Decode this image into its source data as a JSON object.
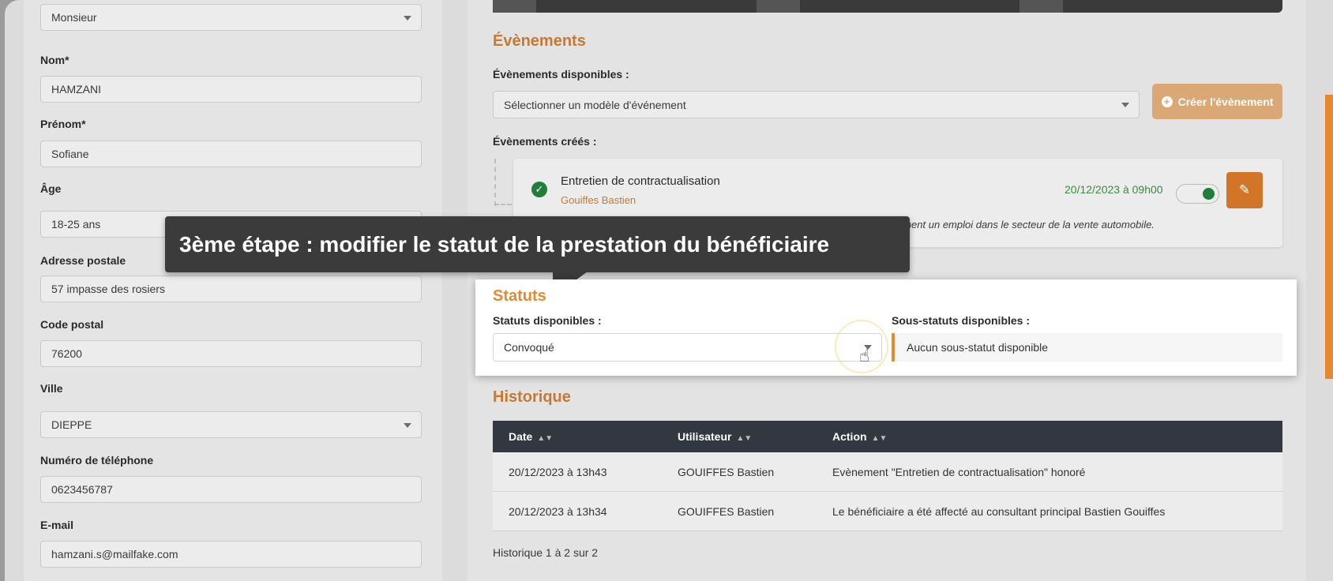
{
  "beneficiary_form": {
    "civility": "Monsieur",
    "fields": [
      {
        "label": "Nom*",
        "value": "HAMZANI"
      },
      {
        "label": "Prénom*",
        "value": "Sofiane"
      },
      {
        "label": "Âge",
        "value": "18-25 ans"
      },
      {
        "label": "Adresse postale",
        "value": "57 impasse des rosiers"
      },
      {
        "label": "Code postal",
        "value": "76200"
      },
      {
        "label": "Ville",
        "value": "DIEPPE"
      },
      {
        "label": "Numéro de téléphone",
        "value": "0623456787"
      },
      {
        "label": "E-mail",
        "value": "hamzani.s@mailfake.com"
      }
    ]
  },
  "events": {
    "title": "Évènements",
    "available_label": "Évènements disponibles :",
    "select_placeholder": "Sélectionner un modèle d'événement",
    "create_button": "Créer l'évènement",
    "created_label": "Évènements créés :",
    "item": {
      "title": "Entretien de contractualisation",
      "author": "Gouiffes Bastien",
      "datetime": "20/12/2023 à 09h00",
      "description_visible": "ement un emploi dans le secteur de la vente automobile."
    }
  },
  "tooltip": "3ème étape : modifier le statut de la prestation du bénéficiaire",
  "statuts": {
    "title": "Statuts",
    "available_label": "Statuts disponibles :",
    "selected": "Convoqué",
    "sub_label": "Sous-statuts disponibles :",
    "sub_value": "Aucun sous-statut disponible"
  },
  "historique": {
    "title": "Historique",
    "columns": [
      "Date",
      "Utilisateur",
      "Action"
    ],
    "rows": [
      {
        "date": "20/12/2023 à 13h43",
        "user": "GOUIFFES Bastien",
        "action": "Evènement \"Entretien de contractualisation\" honoré"
      },
      {
        "date": "20/12/2023 à 13h34",
        "user": "GOUIFFES Bastien",
        "action": "Le bénéficiaire a été affecté au consultant principal Bastien Gouiffes"
      }
    ],
    "footer": "Historique 1 à 2 sur 2"
  },
  "colors": {
    "accent": "#e58a2f",
    "success": "#1e7e3a",
    "table_header": "#333840"
  }
}
